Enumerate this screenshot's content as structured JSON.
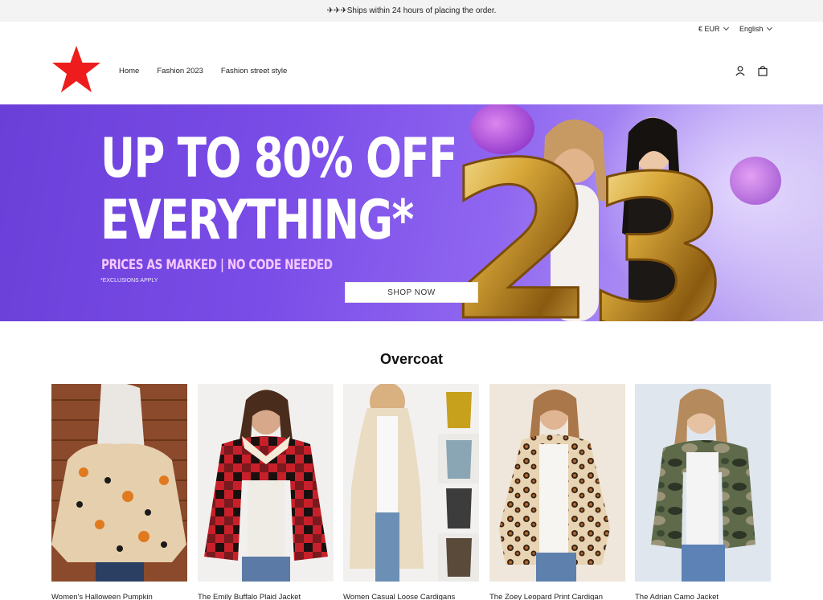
{
  "announcement": "✈✈✈Ships within 24 hours of placing the order.",
  "utility": {
    "currency": "€ EUR",
    "language": "English"
  },
  "nav": {
    "items": [
      "Home",
      "Fashion 2023",
      "Fashion street style"
    ]
  },
  "brand": {
    "logo_color": "#ee1c1c"
  },
  "hero": {
    "line1": "UP TO 80% OFF",
    "line2": "EVERYTHING*",
    "subline": "PRICES AS MARKED | NO CODE NEEDED",
    "note": "*EXCLUSIONS APPLY",
    "button": "SHOP NOW",
    "balloon_number": "23",
    "bg_color": "#7b4de8",
    "subline_color": "#f6c7ff"
  },
  "section": {
    "title": "Overcoat"
  },
  "products": [
    {
      "name": "Women's Halloween Pumpkin"
    },
    {
      "name": "The Emily Buffalo Plaid Jacket"
    },
    {
      "name": "Women Casual Loose Cardigans"
    },
    {
      "name": "The Zoey Leopard Print Cardigan"
    },
    {
      "name": "The Adrian Camo Jacket"
    }
  ],
  "icons": [
    "star-logo-icon",
    "account-icon",
    "cart-icon",
    "chevron-down-icon"
  ]
}
